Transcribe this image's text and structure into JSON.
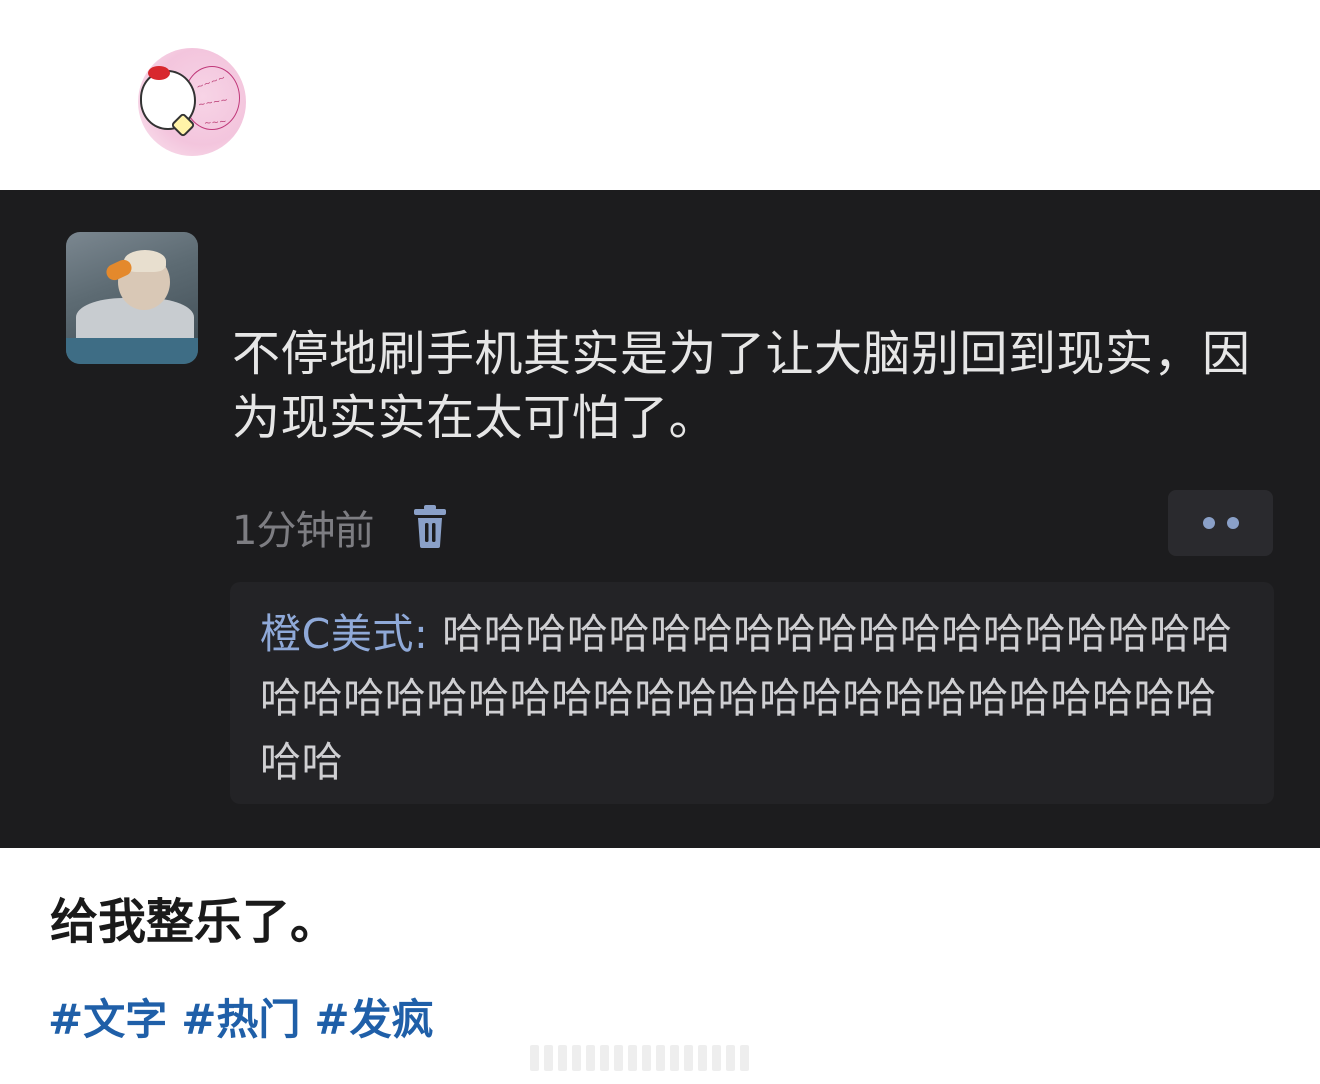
{
  "comment": {
    "text": "不停地刷手机其实是为了让大脑别回到现实，因为现实实在太可怕了。",
    "timestamp": "1分钟前",
    "delete_icon": "trash-icon",
    "more_icon": "more-dots-icon"
  },
  "reply": {
    "author": "橙C美式:",
    "text": "哈哈哈哈哈哈哈哈哈哈哈哈哈哈哈哈哈哈哈哈哈哈哈哈哈哈哈哈哈哈哈哈哈哈哈哈哈哈哈哈哈哈哈哈"
  },
  "post": {
    "caption": "给我整乐了。",
    "tags": [
      "#文字",
      "#热门",
      "#发疯"
    ]
  },
  "colors": {
    "panel_background": "#1c1c1e",
    "reply_background": "#232326",
    "reply_author": "#8fa9d8",
    "tag": "#1f5fa8"
  }
}
